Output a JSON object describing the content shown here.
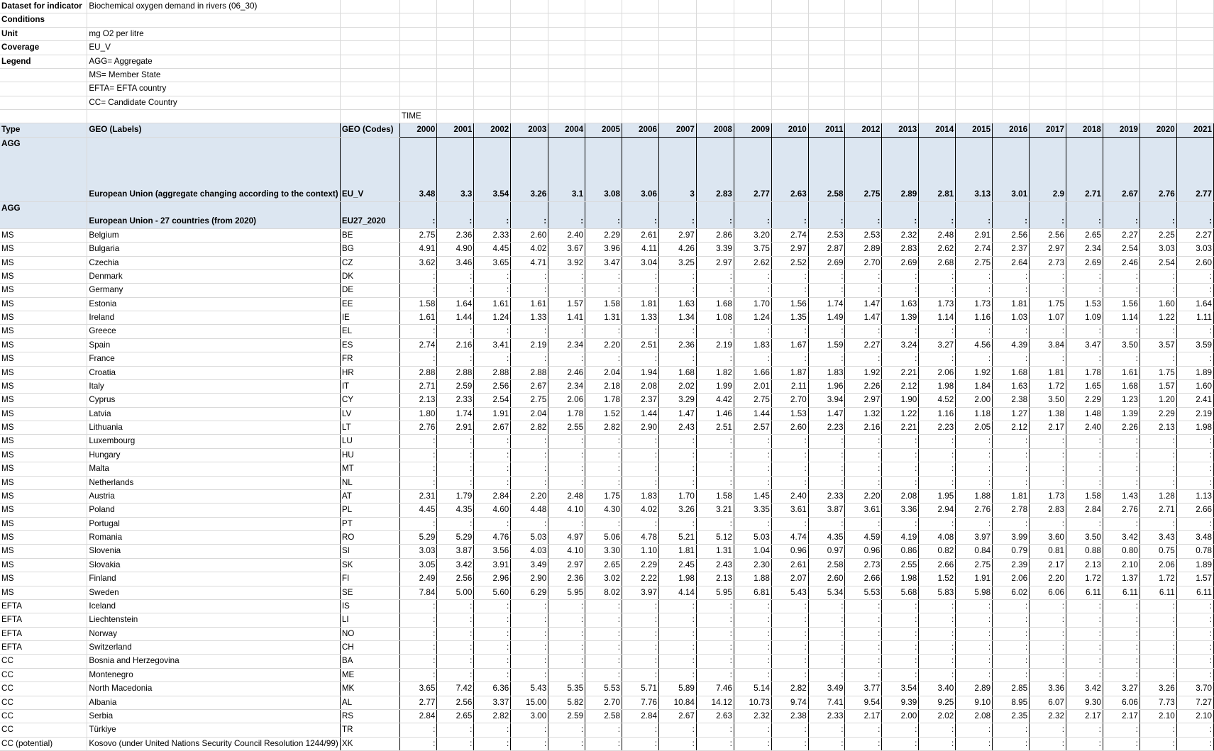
{
  "meta": [
    {
      "label": "Dataset for indicator",
      "value": "Biochemical oxygen demand in rivers (06_30)"
    },
    {
      "label": "Conditions",
      "value": ""
    },
    {
      "label": "Unit",
      "value": "mg O2 per litre"
    },
    {
      "label": "Coverage",
      "value": "EU_V"
    },
    {
      "label": "Legend",
      "value": "AGG= Aggregate"
    },
    {
      "label": "",
      "value": "MS= Member State"
    },
    {
      "label": "",
      "value": "EFTA= EFTA country"
    },
    {
      "label": "",
      "value": "CC= Candidate Country"
    }
  ],
  "time_label": "TIME",
  "headers": {
    "type": "Type",
    "geo_labels": "GEO (Labels)",
    "geo_codes": "GEO (Codes)"
  },
  "years": [
    "2000",
    "2001",
    "2002",
    "2003",
    "2004",
    "2005",
    "2006",
    "2007",
    "2008",
    "2009",
    "2010",
    "2011",
    "2012",
    "2013",
    "2014",
    "2015",
    "2016",
    "2017",
    "2018",
    "2019",
    "2020",
    "2021"
  ],
  "eu_row": {
    "type": "AGG",
    "label": "European Union (aggregate changing according to the context)",
    "code": "EU_V",
    "values": [
      "3.48",
      "3.3",
      "3.54",
      "3.26",
      "3.1",
      "3.08",
      "3.06",
      "3",
      "2.83",
      "2.77",
      "2.63",
      "2.58",
      "2.75",
      "2.89",
      "2.81",
      "3.13",
      "3.01",
      "2.9",
      "2.71",
      "2.67",
      "2.76",
      "2.77"
    ]
  },
  "eu27_row": {
    "type": "AGG",
    "label": "European Union - 27 countries (from 2020)",
    "code": "EU27_2020",
    "values": [
      ":",
      ":",
      ":",
      ":",
      ":",
      ":",
      ":",
      ":",
      ":",
      ":",
      ":",
      ":",
      ":",
      ":",
      ":",
      ":",
      ":",
      ":",
      ":",
      ":",
      ":",
      ":"
    ]
  },
  "rows": [
    {
      "type": "MS",
      "label": "Belgium",
      "code": "BE",
      "values": [
        "2.75",
        "2.36",
        "2.33",
        "2.60",
        "2.40",
        "2.29",
        "2.61",
        "2.97",
        "2.86",
        "3.20",
        "2.74",
        "2.53",
        "2.53",
        "2.32",
        "2.48",
        "2.91",
        "2.56",
        "2.56",
        "2.65",
        "2.27",
        "2.25",
        "2.27"
      ]
    },
    {
      "type": "MS",
      "label": "Bulgaria",
      "code": "BG",
      "values": [
        "4.91",
        "4.90",
        "4.45",
        "4.02",
        "3.67",
        "3.96",
        "4.11",
        "4.26",
        "3.39",
        "3.75",
        "2.97",
        "2.87",
        "2.89",
        "2.83",
        "2.62",
        "2.74",
        "2.37",
        "2.97",
        "2.34",
        "2.54",
        "3.03",
        "3.03"
      ]
    },
    {
      "type": "MS",
      "label": "Czechia",
      "code": "CZ",
      "values": [
        "3.62",
        "3.46",
        "3.65",
        "4.71",
        "3.92",
        "3.47",
        "3.04",
        "3.25",
        "2.97",
        "2.62",
        "2.52",
        "2.69",
        "2.70",
        "2.69",
        "2.68",
        "2.75",
        "2.64",
        "2.73",
        "2.69",
        "2.46",
        "2.54",
        "2.60"
      ]
    },
    {
      "type": "MS",
      "label": "Denmark",
      "code": "DK",
      "values": [
        ":",
        ":",
        ":",
        ":",
        ":",
        ":",
        ":",
        ":",
        ":",
        ":",
        ":",
        ":",
        ":",
        ":",
        ":",
        ":",
        ":",
        ":",
        ":",
        ":",
        ":",
        ":"
      ]
    },
    {
      "type": "MS",
      "label": "Germany",
      "code": "DE",
      "values": [
        ":",
        ":",
        ":",
        ":",
        ":",
        ":",
        ":",
        ":",
        ":",
        ":",
        ":",
        ":",
        ":",
        ":",
        ":",
        ":",
        ":",
        ":",
        ":",
        ":",
        ":",
        ":"
      ]
    },
    {
      "type": "MS",
      "label": "Estonia",
      "code": "EE",
      "values": [
        "1.58",
        "1.64",
        "1.61",
        "1.61",
        "1.57",
        "1.58",
        "1.81",
        "1.63",
        "1.68",
        "1.70",
        "1.56",
        "1.74",
        "1.47",
        "1.63",
        "1.73",
        "1.73",
        "1.81",
        "1.75",
        "1.53",
        "1.56",
        "1.60",
        "1.64"
      ]
    },
    {
      "type": "MS",
      "label": "Ireland",
      "code": "IE",
      "values": [
        "1.61",
        "1.44",
        "1.24",
        "1.33",
        "1.41",
        "1.31",
        "1.33",
        "1.34",
        "1.08",
        "1.24",
        "1.35",
        "1.49",
        "1.47",
        "1.39",
        "1.14",
        "1.16",
        "1.03",
        "1.07",
        "1.09",
        "1.14",
        "1.22",
        "1.11"
      ]
    },
    {
      "type": "MS",
      "label": "Greece",
      "code": "EL",
      "values": [
        ":",
        ":",
        ":",
        ":",
        ":",
        ":",
        ":",
        ":",
        ":",
        ":",
        ":",
        ":",
        ":",
        ":",
        ":",
        ":",
        ":",
        ":",
        ":",
        ":",
        ":",
        ":"
      ]
    },
    {
      "type": "MS",
      "label": "Spain",
      "code": "ES",
      "values": [
        "2.74",
        "2.16",
        "3.41",
        "2.19",
        "2.34",
        "2.20",
        "2.51",
        "2.36",
        "2.19",
        "1.83",
        "1.67",
        "1.59",
        "2.27",
        "3.24",
        "3.27",
        "4.56",
        "4.39",
        "3.84",
        "3.47",
        "3.50",
        "3.57",
        "3.59"
      ]
    },
    {
      "type": "MS",
      "label": "France",
      "code": "FR",
      "values": [
        ":",
        ":",
        ":",
        ":",
        ":",
        ":",
        ":",
        ":",
        ":",
        ":",
        ":",
        ":",
        ":",
        ":",
        ":",
        ":",
        ":",
        ":",
        ":",
        ":",
        ":",
        ":"
      ]
    },
    {
      "type": "MS",
      "label": "Croatia",
      "code": "HR",
      "values": [
        "2.88",
        "2.88",
        "2.88",
        "2.88",
        "2.46",
        "2.04",
        "1.94",
        "1.68",
        "1.82",
        "1.66",
        "1.87",
        "1.83",
        "1.92",
        "2.21",
        "2.06",
        "1.92",
        "1.68",
        "1.81",
        "1.78",
        "1.61",
        "1.75",
        "1.89"
      ]
    },
    {
      "type": "MS",
      "label": "Italy",
      "code": "IT",
      "values": [
        "2.71",
        "2.59",
        "2.56",
        "2.67",
        "2.34",
        "2.18",
        "2.08",
        "2.02",
        "1.99",
        "2.01",
        "2.11",
        "1.96",
        "2.26",
        "2.12",
        "1.98",
        "1.84",
        "1.63",
        "1.72",
        "1.65",
        "1.68",
        "1.57",
        "1.60"
      ]
    },
    {
      "type": "MS",
      "label": "Cyprus",
      "code": "CY",
      "values": [
        "2.13",
        "2.33",
        "2.54",
        "2.75",
        "2.06",
        "1.78",
        "2.37",
        "3.29",
        "4.42",
        "2.75",
        "2.70",
        "3.94",
        "2.97",
        "1.90",
        "4.52",
        "2.00",
        "2.38",
        "3.50",
        "2.29",
        "1.23",
        "1.20",
        "2.41"
      ]
    },
    {
      "type": "MS",
      "label": "Latvia",
      "code": "LV",
      "values": [
        "1.80",
        "1.74",
        "1.91",
        "2.04",
        "1.78",
        "1.52",
        "1.44",
        "1.47",
        "1.46",
        "1.44",
        "1.53",
        "1.47",
        "1.32",
        "1.22",
        "1.16",
        "1.18",
        "1.27",
        "1.38",
        "1.48",
        "1.39",
        "2.29",
        "2.19"
      ]
    },
    {
      "type": "MS",
      "label": "Lithuania",
      "code": "LT",
      "values": [
        "2.76",
        "2.91",
        "2.67",
        "2.82",
        "2.55",
        "2.82",
        "2.90",
        "2.43",
        "2.51",
        "2.57",
        "2.60",
        "2.23",
        "2.16",
        "2.21",
        "2.23",
        "2.05",
        "2.12",
        "2.17",
        "2.40",
        "2.26",
        "2.13",
        "1.98"
      ]
    },
    {
      "type": "MS",
      "label": "Luxembourg",
      "code": "LU",
      "values": [
        ":",
        ":",
        ":",
        ":",
        ":",
        ":",
        ":",
        ":",
        ":",
        ":",
        ":",
        ":",
        ":",
        ":",
        ":",
        ":",
        ":",
        ":",
        ":",
        ":",
        ":",
        ":"
      ]
    },
    {
      "type": "MS",
      "label": "Hungary",
      "code": "HU",
      "values": [
        ":",
        ":",
        ":",
        ":",
        ":",
        ":",
        ":",
        ":",
        ":",
        ":",
        ":",
        ":",
        ":",
        ":",
        ":",
        ":",
        ":",
        ":",
        ":",
        ":",
        ":",
        ":"
      ]
    },
    {
      "type": "MS",
      "label": "Malta",
      "code": "MT",
      "values": [
        ":",
        ":",
        ":",
        ":",
        ":",
        ":",
        ":",
        ":",
        ":",
        ":",
        ":",
        ":",
        ":",
        ":",
        ":",
        ":",
        ":",
        ":",
        ":",
        ":",
        ":",
        ":"
      ]
    },
    {
      "type": "MS",
      "label": "Netherlands",
      "code": "NL",
      "values": [
        ":",
        ":",
        ":",
        ":",
        ":",
        ":",
        ":",
        ":",
        ":",
        ":",
        ":",
        ":",
        ":",
        ":",
        ":",
        ":",
        ":",
        ":",
        ":",
        ":",
        ":",
        ":"
      ]
    },
    {
      "type": "MS",
      "label": "Austria",
      "code": "AT",
      "values": [
        "2.31",
        "1.79",
        "2.84",
        "2.20",
        "2.48",
        "1.75",
        "1.83",
        "1.70",
        "1.58",
        "1.45",
        "2.40",
        "2.33",
        "2.20",
        "2.08",
        "1.95",
        "1.88",
        "1.81",
        "1.73",
        "1.58",
        "1.43",
        "1.28",
        "1.13"
      ]
    },
    {
      "type": "MS",
      "label": "Poland",
      "code": "PL",
      "values": [
        "4.45",
        "4.35",
        "4.60",
        "4.48",
        "4.10",
        "4.30",
        "4.02",
        "3.26",
        "3.21",
        "3.35",
        "3.61",
        "3.87",
        "3.61",
        "3.36",
        "2.94",
        "2.76",
        "2.78",
        "2.83",
        "2.84",
        "2.76",
        "2.71",
        "2.66"
      ]
    },
    {
      "type": "MS",
      "label": "Portugal",
      "code": "PT",
      "values": [
        ":",
        ":",
        ":",
        ":",
        ":",
        ":",
        ":",
        ":",
        ":",
        ":",
        ":",
        ":",
        ":",
        ":",
        ":",
        ":",
        ":",
        ":",
        ":",
        ":",
        ":",
        ":"
      ]
    },
    {
      "type": "MS",
      "label": "Romania",
      "code": "RO",
      "values": [
        "5.29",
        "5.29",
        "4.76",
        "5.03",
        "4.97",
        "5.06",
        "4.78",
        "5.21",
        "5.12",
        "5.03",
        "4.74",
        "4.35",
        "4.59",
        "4.19",
        "4.08",
        "3.97",
        "3.99",
        "3.60",
        "3.50",
        "3.42",
        "3.43",
        "3.48"
      ]
    },
    {
      "type": "MS",
      "label": "Slovenia",
      "code": "SI",
      "values": [
        "3.03",
        "3.87",
        "3.56",
        "4.03",
        "4.10",
        "3.30",
        "1.10",
        "1.81",
        "1.31",
        "1.04",
        "0.96",
        "0.97",
        "0.96",
        "0.86",
        "0.82",
        "0.84",
        "0.79",
        "0.81",
        "0.88",
        "0.80",
        "0.75",
        "0.78"
      ]
    },
    {
      "type": "MS",
      "label": "Slovakia",
      "code": "SK",
      "values": [
        "3.05",
        "3.42",
        "3.91",
        "3.49",
        "2.97",
        "2.65",
        "2.29",
        "2.45",
        "2.43",
        "2.30",
        "2.61",
        "2.58",
        "2.73",
        "2.55",
        "2.66",
        "2.75",
        "2.39",
        "2.17",
        "2.13",
        "2.10",
        "2.06",
        "1.89"
      ]
    },
    {
      "type": "MS",
      "label": "Finland",
      "code": "FI",
      "values": [
        "2.49",
        "2.56",
        "2.96",
        "2.90",
        "2.36",
        "3.02",
        "2.22",
        "1.98",
        "2.13",
        "1.88",
        "2.07",
        "2.60",
        "2.66",
        "1.98",
        "1.52",
        "1.91",
        "2.06",
        "2.20",
        "1.72",
        "1.37",
        "1.72",
        "1.57"
      ]
    },
    {
      "type": "MS",
      "label": "Sweden",
      "code": "SE",
      "values": [
        "7.84",
        "5.00",
        "5.60",
        "6.29",
        "5.95",
        "8.02",
        "3.97",
        "4.14",
        "5.95",
        "6.81",
        "5.43",
        "5.34",
        "5.53",
        "5.68",
        "5.83",
        "5.98",
        "6.02",
        "6.06",
        "6.11",
        "6.11",
        "6.11",
        "6.11"
      ]
    },
    {
      "type": "EFTA",
      "label": "Iceland",
      "code": "IS",
      "values": [
        ":",
        ":",
        ":",
        ":",
        ":",
        ":",
        ":",
        ":",
        ":",
        ":",
        ":",
        ":",
        ":",
        ":",
        ":",
        ":",
        ":",
        ":",
        ":",
        ":",
        ":",
        ":"
      ]
    },
    {
      "type": "EFTA",
      "label": "Liechtenstein",
      "code": "LI",
      "values": [
        ":",
        ":",
        ":",
        ":",
        ":",
        ":",
        ":",
        ":",
        ":",
        ":",
        ":",
        ":",
        ":",
        ":",
        ":",
        ":",
        ":",
        ":",
        ":",
        ":",
        ":",
        ":"
      ]
    },
    {
      "type": "EFTA",
      "label": "Norway",
      "code": "NO",
      "values": [
        ":",
        ":",
        ":",
        ":",
        ":",
        ":",
        ":",
        ":",
        ":",
        ":",
        ":",
        ":",
        ":",
        ":",
        ":",
        ":",
        ":",
        ":",
        ":",
        ":",
        ":",
        ":"
      ]
    },
    {
      "type": "EFTA",
      "label": "Switzerland",
      "code": "CH",
      "values": [
        ":",
        ":",
        ":",
        ":",
        ":",
        ":",
        ":",
        ":",
        ":",
        ":",
        ":",
        ":",
        ":",
        ":",
        ":",
        ":",
        ":",
        ":",
        ":",
        ":",
        ":",
        ":"
      ]
    },
    {
      "type": "CC",
      "label": "Bosnia and Herzegovina",
      "code": "BA",
      "values": [
        ":",
        ":",
        ":",
        ":",
        ":",
        ":",
        ":",
        ":",
        ":",
        ":",
        ":",
        ":",
        ":",
        ":",
        ":",
        ":",
        ":",
        ":",
        ":",
        ":",
        ":",
        ":"
      ]
    },
    {
      "type": "CC",
      "label": "Montenegro",
      "code": "ME",
      "values": [
        ":",
        ":",
        ":",
        ":",
        ":",
        ":",
        ":",
        ":",
        ":",
        ":",
        ":",
        ":",
        ":",
        ":",
        ":",
        ":",
        ":",
        ":",
        ":",
        ":",
        ":",
        ":"
      ]
    },
    {
      "type": "CC",
      "label": "North Macedonia",
      "code": "MK",
      "values": [
        "3.65",
        "7.42",
        "6.36",
        "5.43",
        "5.35",
        "5.53",
        "5.71",
        "5.89",
        "7.46",
        "5.14",
        "2.82",
        "3.49",
        "3.77",
        "3.54",
        "3.40",
        "2.89",
        "2.85",
        "3.36",
        "3.42",
        "3.27",
        "3.26",
        "3.70"
      ]
    },
    {
      "type": "CC",
      "label": "Albania",
      "code": "AL",
      "values": [
        "2.77",
        "2.56",
        "3.37",
        "15.00",
        "5.82",
        "2.70",
        "7.76",
        "10.84",
        "14.12",
        "10.73",
        "9.74",
        "7.41",
        "9.54",
        "9.39",
        "9.25",
        "9.10",
        "8.95",
        "6.07",
        "9.30",
        "6.06",
        "7.73",
        "7.27"
      ]
    },
    {
      "type": "CC",
      "label": "Serbia",
      "code": "RS",
      "values": [
        "2.84",
        "2.65",
        "2.82",
        "3.00",
        "2.59",
        "2.58",
        "2.84",
        "2.67",
        "2.63",
        "2.32",
        "2.38",
        "2.33",
        "2.17",
        "2.00",
        "2.02",
        "2.08",
        "2.35",
        "2.32",
        "2.17",
        "2.17",
        "2.10",
        "2.10"
      ]
    },
    {
      "type": "CC",
      "label": "Türkiye",
      "code": "TR",
      "values": [
        ":",
        ":",
        ":",
        ":",
        ":",
        ":",
        ":",
        ":",
        ":",
        ":",
        ":",
        ":",
        ":",
        ":",
        ":",
        ":",
        ":",
        ":",
        ":",
        ":",
        ":",
        ":"
      ]
    },
    {
      "type": "CC (potential)",
      "label": "Kosovo (under United Nations Security Council Resolution 1244/99)",
      "code": "XK",
      "values": [
        ":",
        ":",
        ":",
        ":",
        ":",
        ":",
        ":",
        ":",
        ":",
        ":",
        ":",
        ":",
        ":",
        ":",
        ":",
        ":",
        ":",
        ":",
        ":",
        ":",
        ":",
        ":"
      ]
    }
  ]
}
